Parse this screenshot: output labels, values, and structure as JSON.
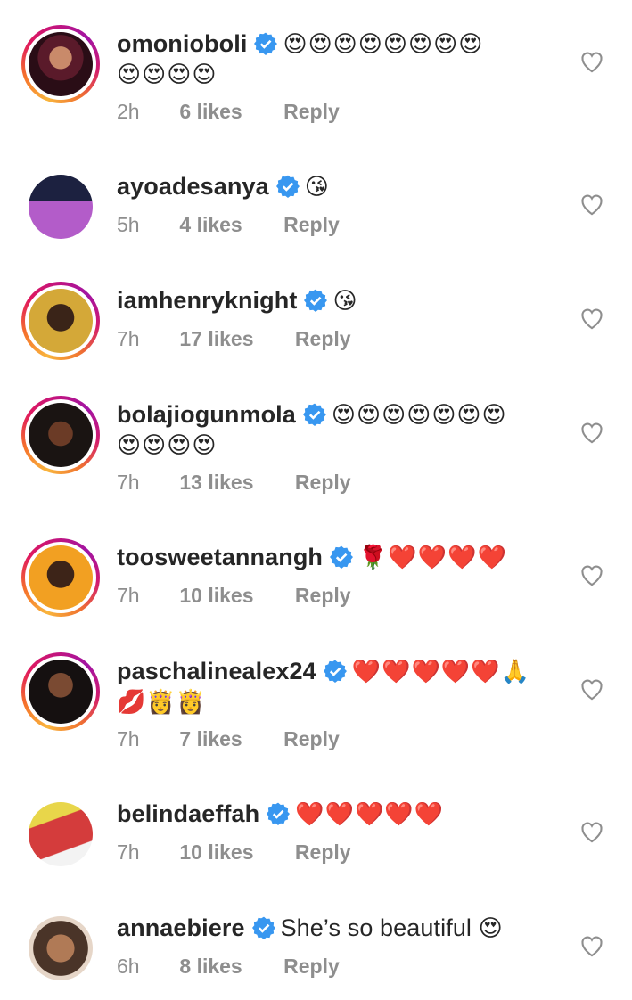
{
  "comments": [
    {
      "username": "omonioboli",
      "emoji_line1": "😍😍😍😍😍😍😍😍",
      "emoji_line2": "😍😍😍😍",
      "text": "",
      "time": "2h",
      "likes": "6 likes",
      "reply": "Reply",
      "story": true
    },
    {
      "username": "ayoadesanya",
      "emoji_line1": "😘",
      "emoji_line2": "",
      "text": "",
      "time": "5h",
      "likes": "4 likes",
      "reply": "Reply",
      "story": false
    },
    {
      "username": "iamhenryknight",
      "emoji_line1": "😘",
      "emoji_line2": "",
      "text": "",
      "time": "7h",
      "likes": "17 likes",
      "reply": "Reply",
      "story": true
    },
    {
      "username": "bolajiogunmola",
      "emoji_line1": "😍😍😍😍😍😍😍",
      "emoji_line2": "😍😍😍😍",
      "text": "",
      "time": "7h",
      "likes": "13 likes",
      "reply": "Reply",
      "story": true
    },
    {
      "username": "toosweetannangh",
      "emoji_line1": "🌹❤️❤️❤️❤️",
      "emoji_line2": "",
      "text": "",
      "time": "7h",
      "likes": "10 likes",
      "reply": "Reply",
      "story": true
    },
    {
      "username": "paschalinealex24",
      "emoji_line1": "❤️❤️❤️❤️❤️🙏",
      "emoji_line2": "💋👸👸",
      "text": "",
      "time": "7h",
      "likes": "7 likes",
      "reply": "Reply",
      "story": true
    },
    {
      "username": "belindaeffah",
      "emoji_line1": "❤️❤️❤️❤️❤️",
      "emoji_line2": "",
      "text": "",
      "time": "7h",
      "likes": "10 likes",
      "reply": "Reply",
      "story": false
    },
    {
      "username": "annaebiere",
      "emoji_line1": "",
      "emoji_line2": "",
      "text": "She’s so beautiful",
      "emoji_after": "😍",
      "time": "6h",
      "likes": "8 likes",
      "reply": "Reply",
      "story": false
    }
  ],
  "colors": {
    "verified": "#3897f0",
    "meta": "#8e8e8e",
    "username": "#262626"
  }
}
